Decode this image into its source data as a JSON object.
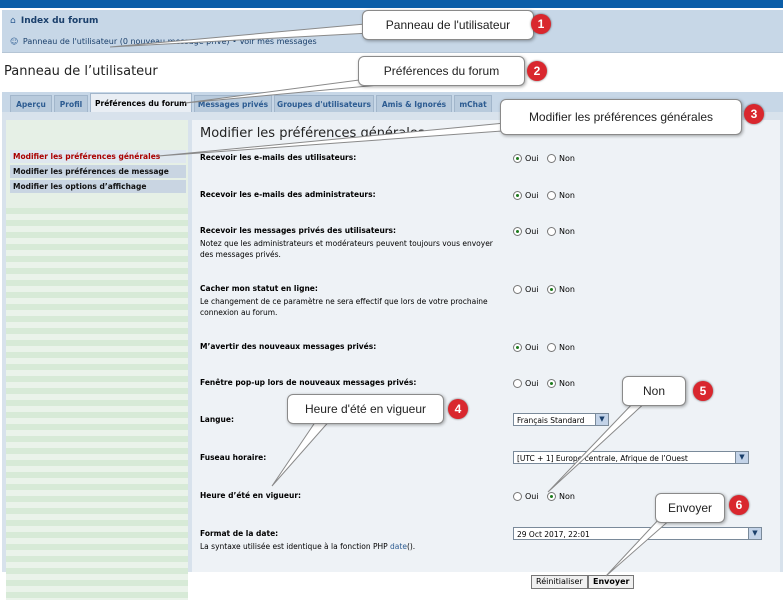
{
  "nav": {
    "index_label": "Index du forum",
    "ucp_link": "Panneau de l'utilisateur (0 nouveau message privé)",
    "separator": "•",
    "view_messages": "Voir mes messages"
  },
  "page_title": "Panneau de l’utilisateur",
  "tabs": [
    {
      "label": "Aperçu"
    },
    {
      "label": "Profil"
    },
    {
      "label": "Préférences du forum",
      "active": true
    },
    {
      "label": "Messages privés"
    },
    {
      "label": "Groupes d'utilisateurs"
    },
    {
      "label": "Amis & Ignorés"
    },
    {
      "label": "mChat"
    }
  ],
  "sidebar": {
    "items": [
      {
        "label": "Modifier les préférences générales",
        "active": true
      },
      {
        "label": "Modifier les préférences de message"
      },
      {
        "label": "Modifier les options d’affichage"
      }
    ]
  },
  "main": {
    "title": "Modifier les préférences générales",
    "yes": "Oui",
    "no": "Non",
    "rows": [
      {
        "label": "Recevoir les e-mails des utilisateurs:",
        "value": "Oui"
      },
      {
        "label": "Recevoir les e-mails des administrateurs:",
        "value": "Oui"
      },
      {
        "label": "Recevoir les messages privés des utilisateurs:",
        "desc": "Notez que les administrateurs et modérateurs peuvent toujours vous envoyer des messages privés.",
        "value": "Oui"
      },
      {
        "label": "Cacher mon statut en ligne:",
        "desc": "Le changement de ce paramètre ne sera effectif que lors de votre prochaine connexion au forum.",
        "value": "Non"
      },
      {
        "label": "M’avertir des nouveaux messages privés:",
        "value": "Oui"
      },
      {
        "label": "Fenêtre pop-up lors de nouveaux messages privés:",
        "value": "Non"
      },
      {
        "label": "Langue:",
        "select": "Français Standard"
      },
      {
        "label": "Fuseau horaire:",
        "select": "[UTC + 1] Europe centrale, Afrique de l’Ouest"
      },
      {
        "label": "Heure d’été en vigueur:",
        "value": "Non"
      },
      {
        "label": "Format de la date:",
        "desc_prefix": "La syntaxe utilisée est identique à la fonction PHP ",
        "desc_link": "date",
        "desc_suffix": "().",
        "select": "29 Oct 2017, 22:01"
      }
    ]
  },
  "buttons": {
    "reset": "Réinitialiser",
    "submit": "Envoyer"
  },
  "annotations": [
    {
      "num": "1",
      "text": "Panneau de l'utilisateur"
    },
    {
      "num": "2",
      "text": "Préférences du forum"
    },
    {
      "num": "3",
      "text": "Modifier les préférences générales"
    },
    {
      "num": "4",
      "text": "Heure d'été en vigueur"
    },
    {
      "num": "5",
      "text": "Non"
    },
    {
      "num": "6",
      "text": "Envoyer"
    }
  ],
  "colors": {
    "topbar": "#0b5ea8",
    "accent_link": "#2c5b91",
    "active_sidebar": "#aa0000",
    "badge": "#d9272e"
  }
}
